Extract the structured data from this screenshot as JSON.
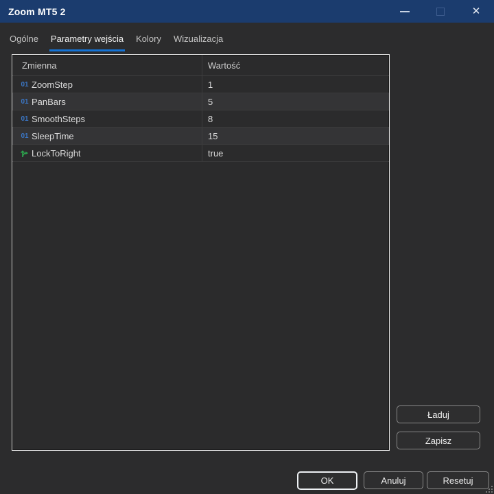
{
  "window": {
    "title": "Zoom MT5 2",
    "controls": {
      "minimize": "minimize",
      "maximize": "maximize",
      "close": "✕"
    }
  },
  "tabs": [
    {
      "label": "Ogólne",
      "active": false
    },
    {
      "label": "Parametry wejścia",
      "active": true
    },
    {
      "label": "Kolory",
      "active": false
    },
    {
      "label": "Wizualizacja",
      "active": false
    }
  ],
  "parameters_table": {
    "columns": [
      "Zmienna",
      "Wartość"
    ],
    "rows": [
      {
        "icon": "integer-param-icon",
        "icon_glyph": "01",
        "name": "ZoomStep",
        "value": "1"
      },
      {
        "icon": "integer-param-icon",
        "icon_glyph": "01",
        "name": "PanBars",
        "value": "5"
      },
      {
        "icon": "integer-param-icon",
        "icon_glyph": "01",
        "name": "SmoothSteps",
        "value": "8"
      },
      {
        "icon": "integer-param-icon",
        "icon_glyph": "01",
        "name": "SleepTime",
        "value": "15"
      },
      {
        "icon": "bool-param-icon",
        "name": "LockToRight",
        "value": "true"
      }
    ]
  },
  "side_buttons": {
    "load": "Ładuj",
    "save": "Zapisz"
  },
  "bottom_buttons": {
    "ok": "OK",
    "cancel": "Anuluj",
    "reset": "Resetuj"
  },
  "colors": {
    "titlebar": "#1b3c6e",
    "accent_blue": "#1473d6",
    "integer_icon": "#3b76c4",
    "bool_icon": "#2da44e",
    "panel_border": "#e2e2e2",
    "row_alt": "#343436"
  }
}
